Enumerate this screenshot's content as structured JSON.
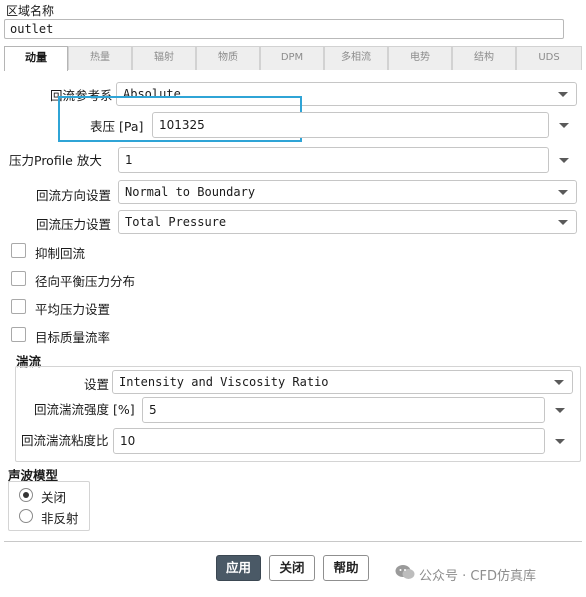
{
  "zone": {
    "label": "区域名称",
    "name": "outlet"
  },
  "tabs": [
    "动量",
    "热量",
    "辐射",
    "物质",
    "DPM",
    "多相流",
    "电势",
    "结构",
    "UDS"
  ],
  "active_tab": "动量",
  "momentum": {
    "backflow_ref_frame": {
      "label": "回流参考系",
      "value": "Absolute"
    },
    "gauge_pressure": {
      "label": "表压 [Pa]",
      "value": "101325"
    },
    "pressure_profile_multiplier": {
      "label": "压力Profile 放大",
      "value": "1"
    },
    "backflow_direction": {
      "label": "回流方向设置",
      "value": "Normal to Boundary"
    },
    "backflow_pressure": {
      "label": "回流压力设置",
      "value": "Total Pressure"
    },
    "checkboxes": [
      {
        "label": "抑制回流",
        "checked": false
      },
      {
        "label": "径向平衡压力分布",
        "checked": false
      },
      {
        "label": "平均压力设置",
        "checked": false
      },
      {
        "label": "目标质量流率",
        "checked": false
      }
    ]
  },
  "turbulence": {
    "title": "湍流",
    "method": {
      "label": "设置",
      "value": "Intensity and Viscosity Ratio"
    },
    "intensity": {
      "label": "回流湍流强度 [%]",
      "value": "5"
    },
    "viscosity_ratio": {
      "label": "回流湍流粘度比",
      "value": "10"
    }
  },
  "acoustic": {
    "title": "声波模型",
    "options": [
      {
        "label": "关闭",
        "selected": true
      },
      {
        "label": "非反射",
        "selected": false
      }
    ]
  },
  "buttons": {
    "apply": "应用",
    "close": "关闭",
    "help": "帮助"
  },
  "watermark": {
    "text": "公众号 · CFD仿真库"
  },
  "colors": {
    "primary_button": "#4a5966",
    "highlight": "#2fa4d6"
  }
}
